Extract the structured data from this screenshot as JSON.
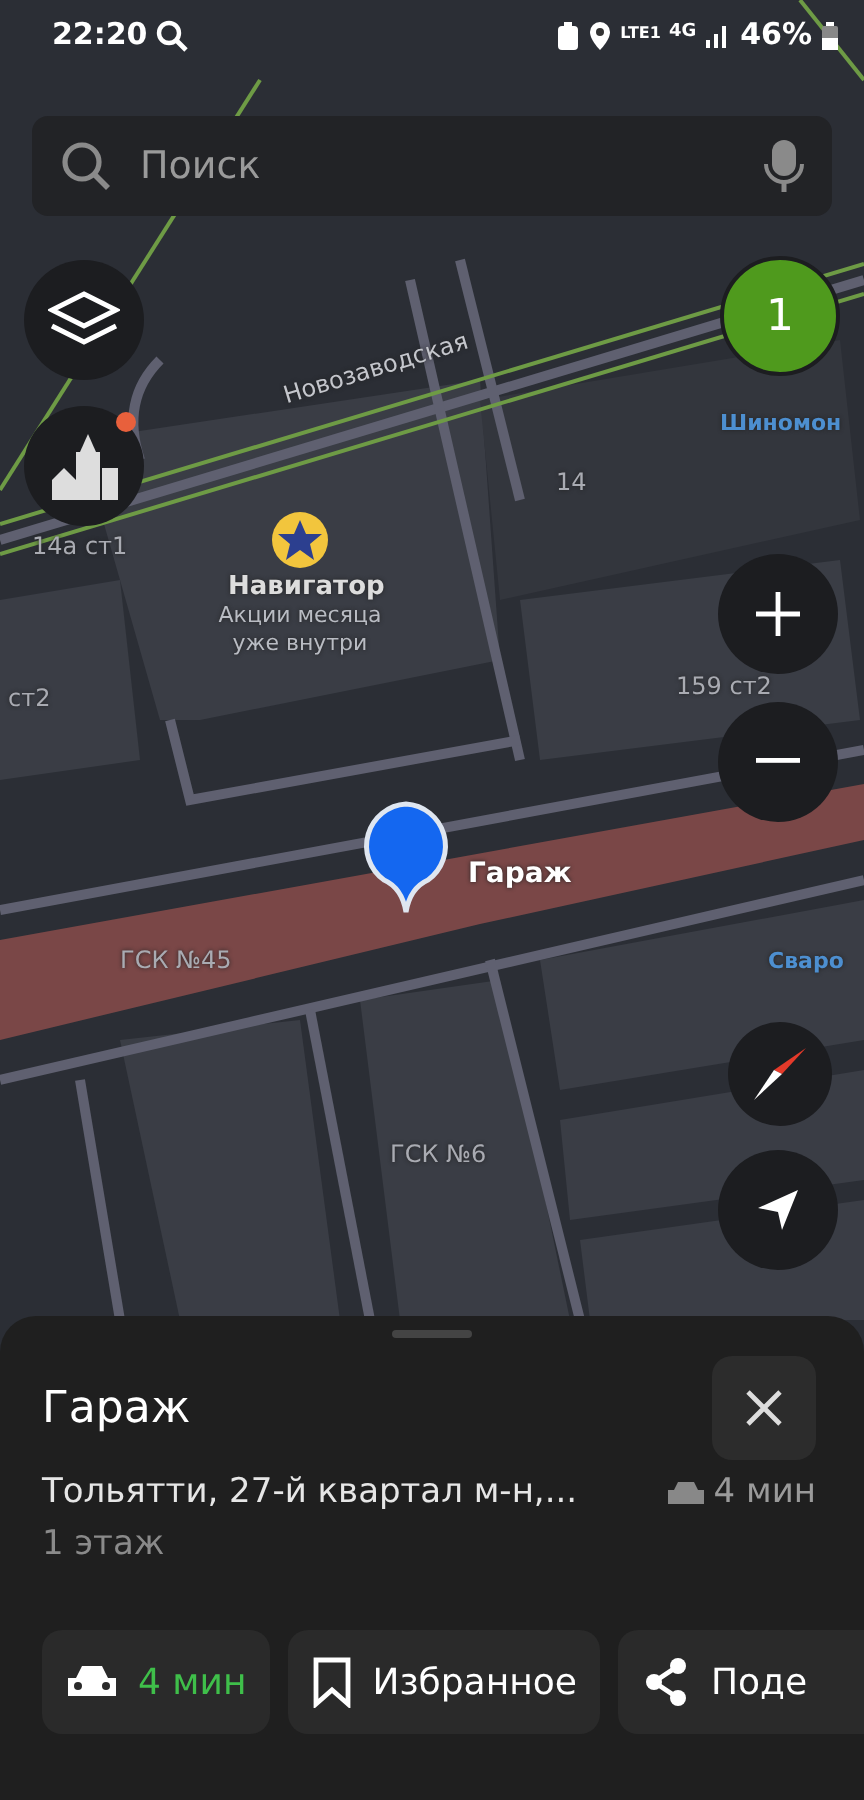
{
  "status_bar": {
    "time": "22:20",
    "network": "4G",
    "carrier": "LTE1",
    "battery": "46%"
  },
  "search": {
    "placeholder": "Поиск"
  },
  "map_labels": [
    {
      "text": "Новозаводская",
      "kind": "street"
    },
    {
      "text": "14а ст1",
      "kind": "house"
    },
    {
      "text": "14",
      "kind": "house"
    },
    {
      "text": "ст2",
      "kind": "house"
    },
    {
      "text": "159 ст2",
      "kind": "house"
    },
    {
      "text": "ГСК №45",
      "kind": "area"
    },
    {
      "text": "ГСК №6",
      "kind": "area"
    },
    {
      "text": "Шиномон",
      "kind": "poi"
    },
    {
      "text": "Сваро",
      "kind": "poi"
    }
  ],
  "promo": {
    "title": "Навигатор",
    "subtitle": "Акции месяца уже внутри"
  },
  "pin": {
    "label": "Гараж"
  },
  "badge": {
    "count": "1"
  },
  "layers_notification": true,
  "sheet": {
    "title": "Гараж",
    "address": "Тольятти, 27-й квартал м-н,...",
    "drive_time": "4 мин",
    "floor": "1 этаж",
    "actions": [
      {
        "kind": "route",
        "label": "4 мин"
      },
      {
        "kind": "favorite",
        "label": "Избранное"
      },
      {
        "kind": "share",
        "label": "Поде"
      }
    ]
  }
}
